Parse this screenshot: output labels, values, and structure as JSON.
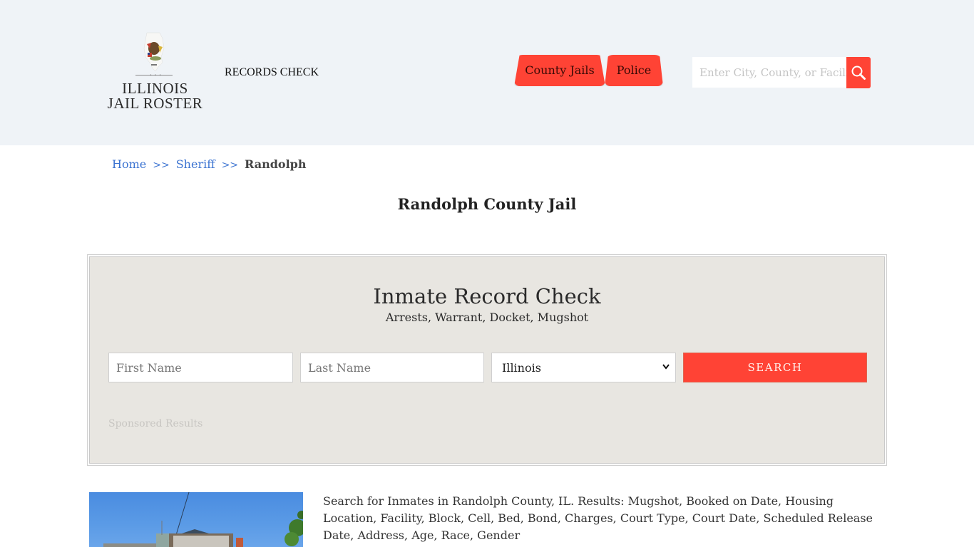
{
  "header": {
    "logo_line1": "ILLINOIS",
    "logo_line2": "JAIL ROSTER",
    "logo_dots": "• • •",
    "records_check": "RECORDS CHECK",
    "tabs": [
      {
        "label": "County Jails"
      },
      {
        "label": "Police"
      }
    ],
    "search": {
      "placeholder": "Enter City, County, or Facility",
      "icon": "search-icon"
    }
  },
  "breadcrumb": {
    "items": [
      {
        "label": "Home"
      },
      {
        "label": "Sheriff"
      }
    ],
    "separator": ">>",
    "current": "Randolph"
  },
  "page_title": "Randolph County Jail",
  "record_check": {
    "title": "Inmate Record Check",
    "subtitle": "Arrests, Warrant, Docket, Mugshot",
    "first_name_placeholder": "First Name",
    "last_name_placeholder": "Last Name",
    "state_selected": "Illinois",
    "search_label": "SEARCH",
    "sponsored": "Sponsored Results"
  },
  "description": "Search for Inmates in Randolph County, IL. Results: Mugshot, Booked on Date, Housing Location, Facility, Block, Cell, Bed, Bond, Charges, Court Type, Court Date, Scheduled Release Date, Address, Age, Race, Gender",
  "colors": {
    "accent": "#ff4335",
    "header_bg": "#eff3f7",
    "panel_bg": "#e8e6e1",
    "link": "#3b73d1"
  }
}
